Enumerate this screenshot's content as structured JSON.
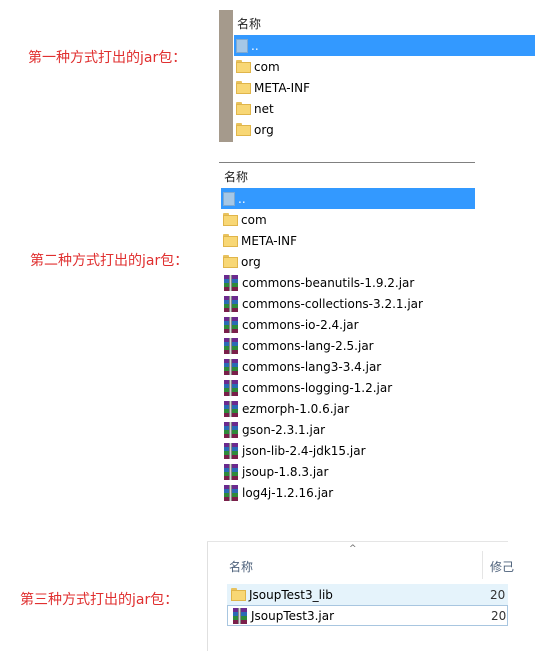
{
  "captions": {
    "first": "第一种方式打出的jar包：",
    "second": "第二种方式打出的jar包：",
    "third": "第三种方式打出的jar包："
  },
  "panel1": {
    "header": "名称",
    "items": [
      {
        "name": "..",
        "type": "updir",
        "selected": true
      },
      {
        "name": "com",
        "type": "folder"
      },
      {
        "name": "META-INF",
        "type": "folder"
      },
      {
        "name": "net",
        "type": "folder"
      },
      {
        "name": "org",
        "type": "folder"
      }
    ]
  },
  "panel2": {
    "header": "名称",
    "items": [
      {
        "name": "..",
        "type": "updir",
        "selected": true
      },
      {
        "name": "com",
        "type": "folder"
      },
      {
        "name": "META-INF",
        "type": "folder"
      },
      {
        "name": "org",
        "type": "folder"
      },
      {
        "name": "commons-beanutils-1.9.2.jar",
        "type": "jar"
      },
      {
        "name": "commons-collections-3.2.1.jar",
        "type": "jar"
      },
      {
        "name": "commons-io-2.4.jar",
        "type": "jar"
      },
      {
        "name": "commons-lang-2.5.jar",
        "type": "jar"
      },
      {
        "name": "commons-lang3-3.4.jar",
        "type": "jar"
      },
      {
        "name": "commons-logging-1.2.jar",
        "type": "jar"
      },
      {
        "name": "ezmorph-1.0.6.jar",
        "type": "jar"
      },
      {
        "name": "gson-2.3.1.jar",
        "type": "jar"
      },
      {
        "name": "json-lib-2.4-jdk15.jar",
        "type": "jar"
      },
      {
        "name": "jsoup-1.8.3.jar",
        "type": "jar"
      },
      {
        "name": "log4j-1.2.16.jar",
        "type": "jar"
      }
    ]
  },
  "panel3": {
    "header_name": "名称",
    "header_modified": "修己",
    "sort_arrow": "^",
    "items": [
      {
        "name": "JsoupTest3_lib",
        "type": "folder",
        "date": "20"
      },
      {
        "name": "JsoupTest3.jar",
        "type": "jar",
        "date": "20"
      }
    ]
  },
  "colors": {
    "caption": "#e03030",
    "selection": "#3399ff",
    "hover": "#e5f3fb",
    "folder": "#f8d775"
  }
}
